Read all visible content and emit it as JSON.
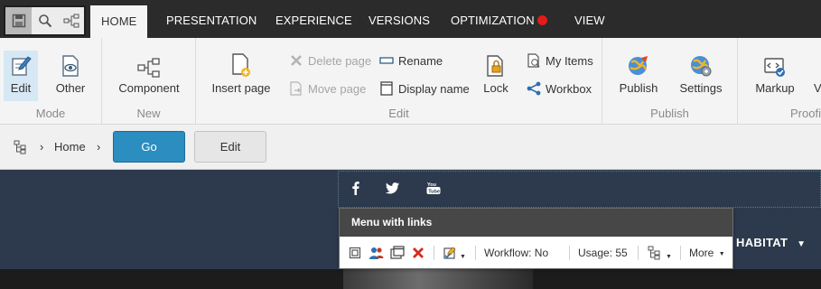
{
  "tabs": [
    {
      "label": "HOME"
    },
    {
      "label": "PRESENTATION"
    },
    {
      "label": "EXPERIENCE"
    },
    {
      "label": "VERSIONS"
    },
    {
      "label": "OPTIMIZATION"
    },
    {
      "label": "VIEW"
    }
  ],
  "quick_access": [
    {
      "icon": "save-icon"
    },
    {
      "icon": "search-icon"
    },
    {
      "icon": "tree-icon"
    }
  ],
  "ribbon": {
    "mode": {
      "label": "Mode",
      "edit": "Edit",
      "other": "Other"
    },
    "new": {
      "label": "New",
      "component": "Component"
    },
    "edit": {
      "label": "Edit",
      "insert_page": "Insert page",
      "delete_page": "Delete page",
      "move_page": "Move page",
      "rename": "Rename",
      "display_name": "Display name",
      "lock": "Lock",
      "my_items": "My Items",
      "workbox": "Workbox"
    },
    "publish": {
      "label": "Publish",
      "publish": "Publish",
      "settings": "Settings"
    },
    "proofing": {
      "label": "Proofi",
      "markup": "Markup",
      "more": "V"
    }
  },
  "breadcrumb": {
    "item": "Home",
    "go": "Go",
    "edit": "Edit"
  },
  "page": {
    "brand": "HABITAT",
    "social": [
      "f",
      "twitter",
      "youtube"
    ]
  },
  "rendering_toolbar": {
    "title": "Menu with links",
    "workflow": "Workflow: No",
    "usage": "Usage: 55",
    "more": "More"
  },
  "colors": {
    "accent": "#2b8dc0",
    "tabbar": "#2b2b2b",
    "page_bg": "#2d3a4d",
    "alert_dot": "#e21b1b"
  }
}
